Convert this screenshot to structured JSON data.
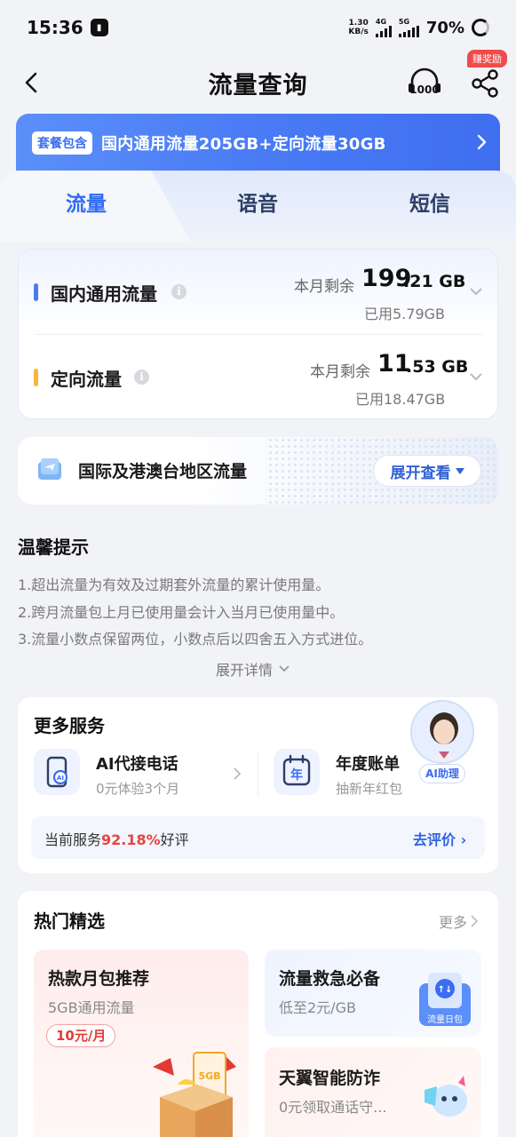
{
  "status_bar": {
    "time": "15:36",
    "net_speed_value": "1.30",
    "net_speed_unit": "KB/s",
    "sig1": "4G",
    "sig2": "5G",
    "battery": "70%"
  },
  "header": {
    "title": "流量查询",
    "reward_badge": "赚奖励",
    "back_icon": "chevron-left-icon",
    "service_icon": "10000-headset-icon",
    "share_icon": "share-icon"
  },
  "plan_banner": {
    "tag": "套餐包含",
    "text": "国内通用流量205GB+定向流量30GB"
  },
  "tabs": [
    {
      "label": "流量",
      "active": true
    },
    {
      "label": "语音",
      "active": false
    },
    {
      "label": "短信",
      "active": false
    }
  ],
  "flow_items": [
    {
      "name": "国内通用流量",
      "remain_label": "本月剩余",
      "remain_int": "199",
      "remain_dec": ".21 GB",
      "used": "已用5.79GB",
      "color": "#4a7bf5"
    },
    {
      "name": "定向流量",
      "remain_label": "本月剩余",
      "remain_int": "11",
      "remain_dec": ".53 GB",
      "used": "已用18.47GB",
      "color": "#f5b73b"
    }
  ],
  "intl": {
    "title": "国际及港澳台地区流量",
    "button": "展开查看"
  },
  "tips": {
    "title": "温馨提示",
    "items": [
      "1.超出流量为有效及过期套外流量的累计使用量。",
      "2.跨月流量包上月已使用量会计入当月已使用量中。",
      "3.流量小数点保留两位，小数点后以四舍五入方式进位。"
    ],
    "expand": "展开详情"
  },
  "services": {
    "title": "更多服务",
    "items": [
      {
        "name": "AI代接电话",
        "sub": "0元体验3个月"
      },
      {
        "name": "年度账单",
        "sub": "抽新年红包",
        "icon_text": "年"
      }
    ],
    "rating_prefix": "当前服务",
    "rating_pct": "92.18%",
    "rating_suffix": "好评",
    "rate_link": "去评价",
    "ai_label": "AI助理"
  },
  "hot": {
    "title": "热门精选",
    "more": "更多",
    "left": {
      "title": "热款月包推荐",
      "sub": "5GB通用流量",
      "price": "10元/月",
      "badge": "5GB"
    },
    "right1": {
      "title": "流量救急必备",
      "sub": "低至2元/GB",
      "badge": "流量日包"
    },
    "right2": {
      "title": "天翼智能防诈",
      "sub": "0元领取通话守..."
    }
  }
}
